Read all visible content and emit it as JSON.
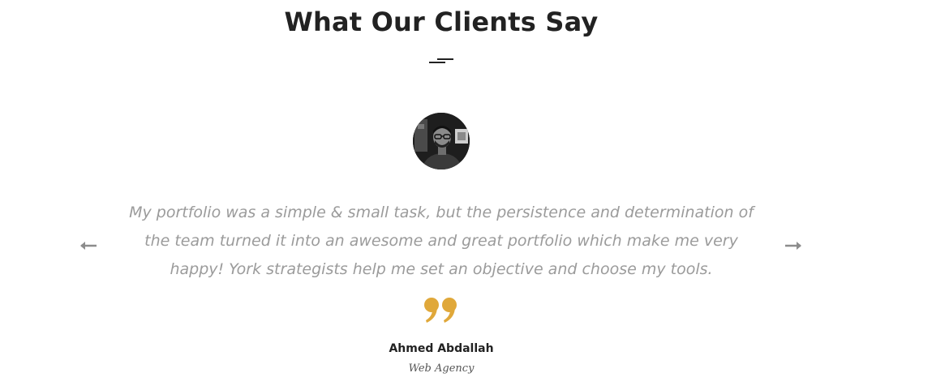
{
  "section": {
    "title": "What Our Clients Say"
  },
  "testimonial": {
    "quote": "My portfolio was a simple & small task, but the persistence and determination of the team turned it into an awesome and great portfolio which make me very happy! York strategists help me set an objective and choose my tools.",
    "author_name": "Ahmed Abdallah",
    "author_company": "Web Agency",
    "avatar_icon": "person-avatar",
    "quote_icon": "closing-quote-icon"
  },
  "navigation": {
    "prev_icon": "arrow-left-icon",
    "next_icon": "arrow-right-icon"
  },
  "colors": {
    "title": "#222222",
    "quote_text": "#9b9b9b",
    "accent": "#e0a83a",
    "arrow": "#8c8c8c"
  }
}
